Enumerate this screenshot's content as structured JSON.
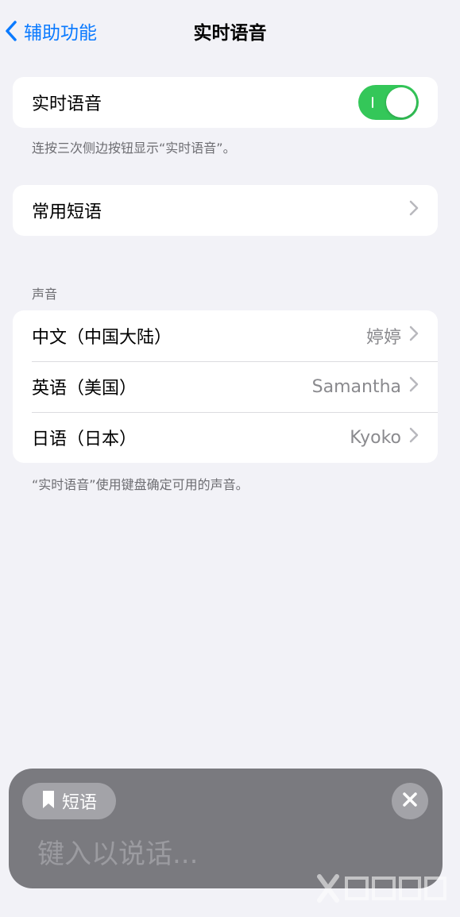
{
  "nav": {
    "back_label": "辅助功能",
    "title": "实时语音"
  },
  "live_speech": {
    "label": "实时语音",
    "toggle_on": true,
    "footnote": "连按三次侧边按钮显示“实时语音”。"
  },
  "phrases": {
    "label": "常用短语"
  },
  "voices": {
    "header": "声音",
    "items": [
      {
        "label": "中文（中国大陆）",
        "value": "婷婷"
      },
      {
        "label": "英语（美国）",
        "value": "Samantha"
      },
      {
        "label": "日语（日本）",
        "value": "Kyoko"
      }
    ],
    "footnote": "“实时语音”使用键盘确定可用的声音。"
  },
  "panel": {
    "chip_label": "短语",
    "placeholder": "键入以说话..."
  },
  "colors": {
    "accent": "#0a7aff",
    "toggle_on": "#34c759"
  }
}
